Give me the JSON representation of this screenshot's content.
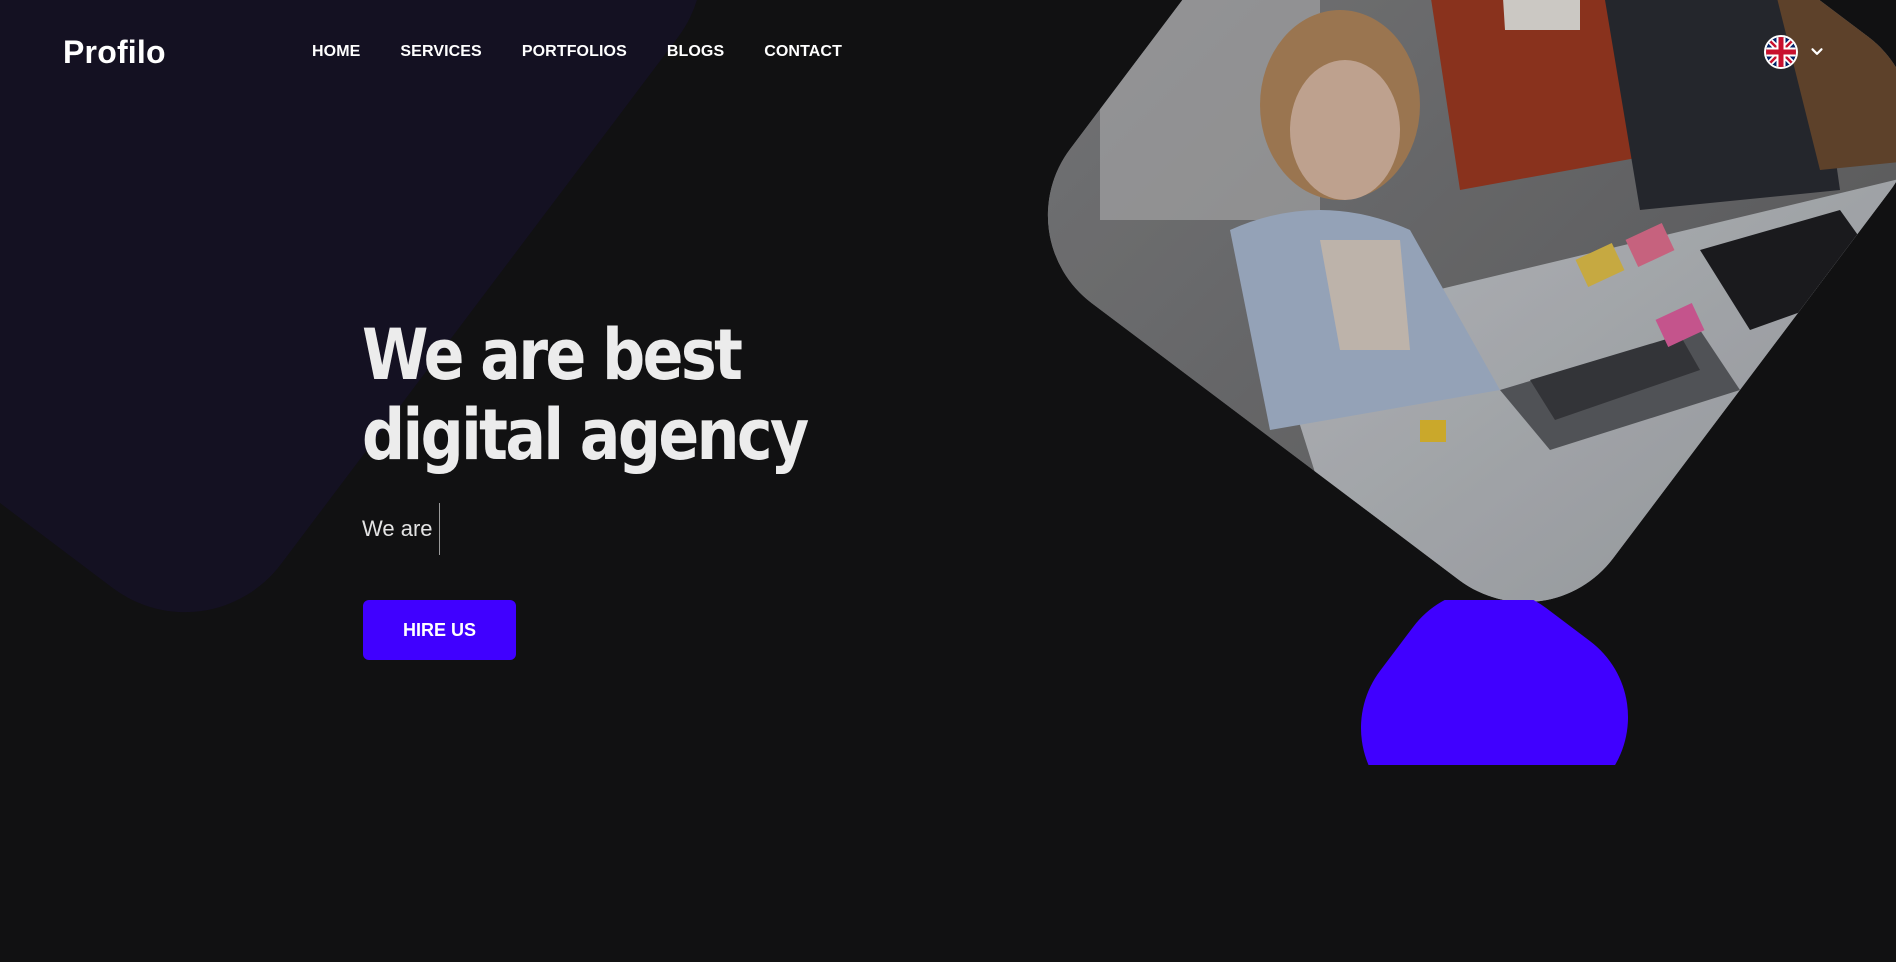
{
  "header": {
    "logo": "Profilo",
    "nav": [
      "HOME",
      "SERVICES",
      "PORTFOLIOS",
      "BLOGS",
      "CONTACT"
    ],
    "language": {
      "flag_icon": "uk-flag-icon",
      "dropdown_icon": "chevron-down-icon"
    }
  },
  "hero": {
    "title": "We are best digital agency",
    "subtitle": "We are",
    "cta_label": "HIRE US",
    "image_alt": "team-meeting-photo"
  },
  "colors": {
    "background": "#111112",
    "accent": "#4000ff",
    "text": "#ffffff",
    "bg_shape": "#141122"
  }
}
